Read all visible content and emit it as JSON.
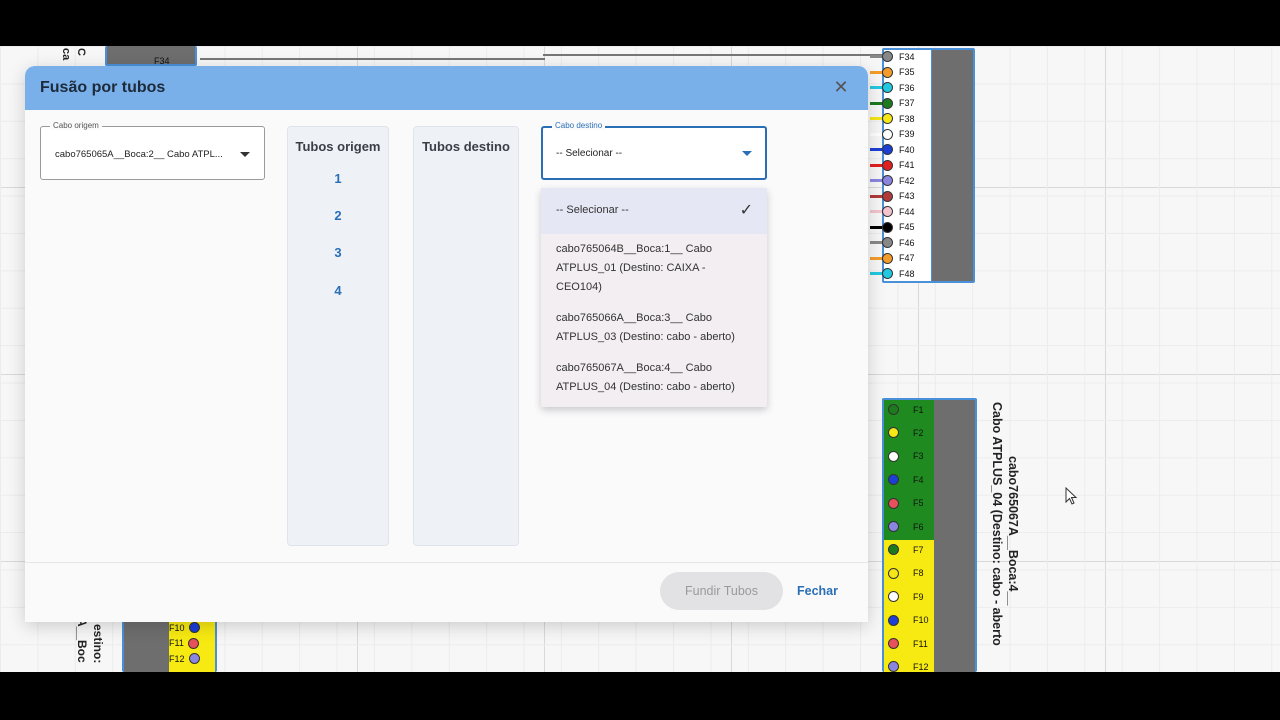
{
  "modal": {
    "title": "Fusão por tubos",
    "origin_select": {
      "label": "Cabo origem",
      "value": "cabo765065A__Boca:2__ Cabo ATPL..."
    },
    "origin_tubes": {
      "title": "Tubos origem",
      "items": [
        "1",
        "2",
        "3",
        "4"
      ]
    },
    "dest_tubes": {
      "title": "Tubos destino"
    },
    "dest_select": {
      "label": "Cabo destino",
      "value": "-- Selecionar --",
      "options": [
        {
          "label": "-- Selecionar --",
          "selected": true
        },
        {
          "label": "cabo765064B__Boca:1__ Cabo ATPLUS_01 (Destino: CAIXA - CEO104)"
        },
        {
          "label": "cabo765066A__Boca:3__ Cabo ATPLUS_03 (Destino: cabo - aberto)"
        },
        {
          "label": "cabo765067A__Boca:4__ Cabo ATPLUS_04 (Destino: cabo - aberto)"
        }
      ]
    },
    "merge_button": "Fundir Tubos",
    "close_button": "Fechar"
  },
  "canvas": {
    "top_right_fibers": [
      "F34",
      "F35",
      "F36",
      "F37",
      "F38",
      "F39",
      "F40",
      "F41",
      "F42",
      "F43",
      "F44",
      "F45",
      "F46",
      "F47",
      "F48"
    ],
    "top_right_colors": [
      "#888888",
      "#f39c2b",
      "#22c8e0",
      "#1e7a1e",
      "#f5e617",
      "#ffffff",
      "#1c3fd6",
      "#e02020",
      "#8a86e0",
      "#b03a3a",
      "#f2c4cf",
      "#000000",
      "#888888",
      "#f39c2b",
      "#22c8e0"
    ],
    "bottom_right_fibers": [
      "F1",
      "F2",
      "F3",
      "F4",
      "F5",
      "F6",
      "F7",
      "F8",
      "F9",
      "F10",
      "F11",
      "F12"
    ],
    "bottom_right_colors": [
      "#1e7a1e",
      "#f5e617",
      "#ffffff",
      "#1c3fd6",
      "#e8505b",
      "#8a86e0",
      "#1e7a1e",
      "#f5e617",
      "#ffffff",
      "#1c3fd6",
      "#e8505b",
      "#8a86e0"
    ],
    "bottom_right_cable_label_1": "cabo765067A__Boca:4__",
    "bottom_right_cable_label_2": "Cabo ATPLUS_04 (Destino: cabo - aberto",
    "bottom_left_fibers": [
      "F10",
      "F11",
      "F12"
    ],
    "bottom_left_colors": [
      "#1c3fd6",
      "#e8505b",
      "#8a86e0"
    ],
    "bottom_left_label_1": "A__Boc",
    "bottom_left_label_2": "estino:",
    "top_left_fiber": "F34",
    "top_left_label_1": "ca",
    "top_left_label_2": "C"
  }
}
